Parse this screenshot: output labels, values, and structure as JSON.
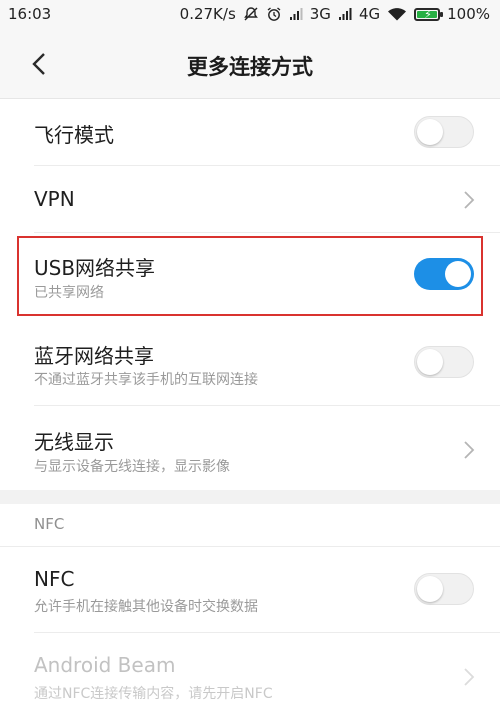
{
  "status_bar": {
    "time": "16:03",
    "speed": "0.27K/s",
    "network_3g": "3G",
    "network_4g": "4G",
    "battery": "100%",
    "icons": [
      "mute-icon",
      "alarm-icon",
      "signal-icon",
      "signal-icon",
      "wifi-icon",
      "battery-charging-icon"
    ]
  },
  "header": {
    "title": "更多连接方式"
  },
  "items": [
    {
      "label": "飞行模式",
      "control": "toggle",
      "checked": false
    },
    {
      "label": "VPN",
      "control": "chevron"
    },
    {
      "label": "USB网络共享",
      "subtitle": "已共享网络",
      "control": "toggle",
      "checked": true,
      "highlighted": true
    },
    {
      "label": "蓝牙网络共享",
      "subtitle": "不通过蓝牙共享该手机的互联网连接",
      "control": "toggle",
      "checked": false
    },
    {
      "label": "无线显示",
      "subtitle": "与显示设备无线连接，显示影像",
      "control": "chevron"
    }
  ],
  "nfc_section": {
    "header": "NFC",
    "items": [
      {
        "label": "NFC",
        "subtitle": "允许手机在接触其他设备时交换数据",
        "control": "toggle",
        "checked": false
      },
      {
        "label": "Android Beam",
        "subtitle": "通过NFC连接传输内容，请先开启NFC",
        "control": "chevron",
        "disabled": true
      }
    ]
  },
  "colors": {
    "accent": "#1d8fe6",
    "highlight_border": "#d9332f",
    "battery_green": "#27b043"
  }
}
